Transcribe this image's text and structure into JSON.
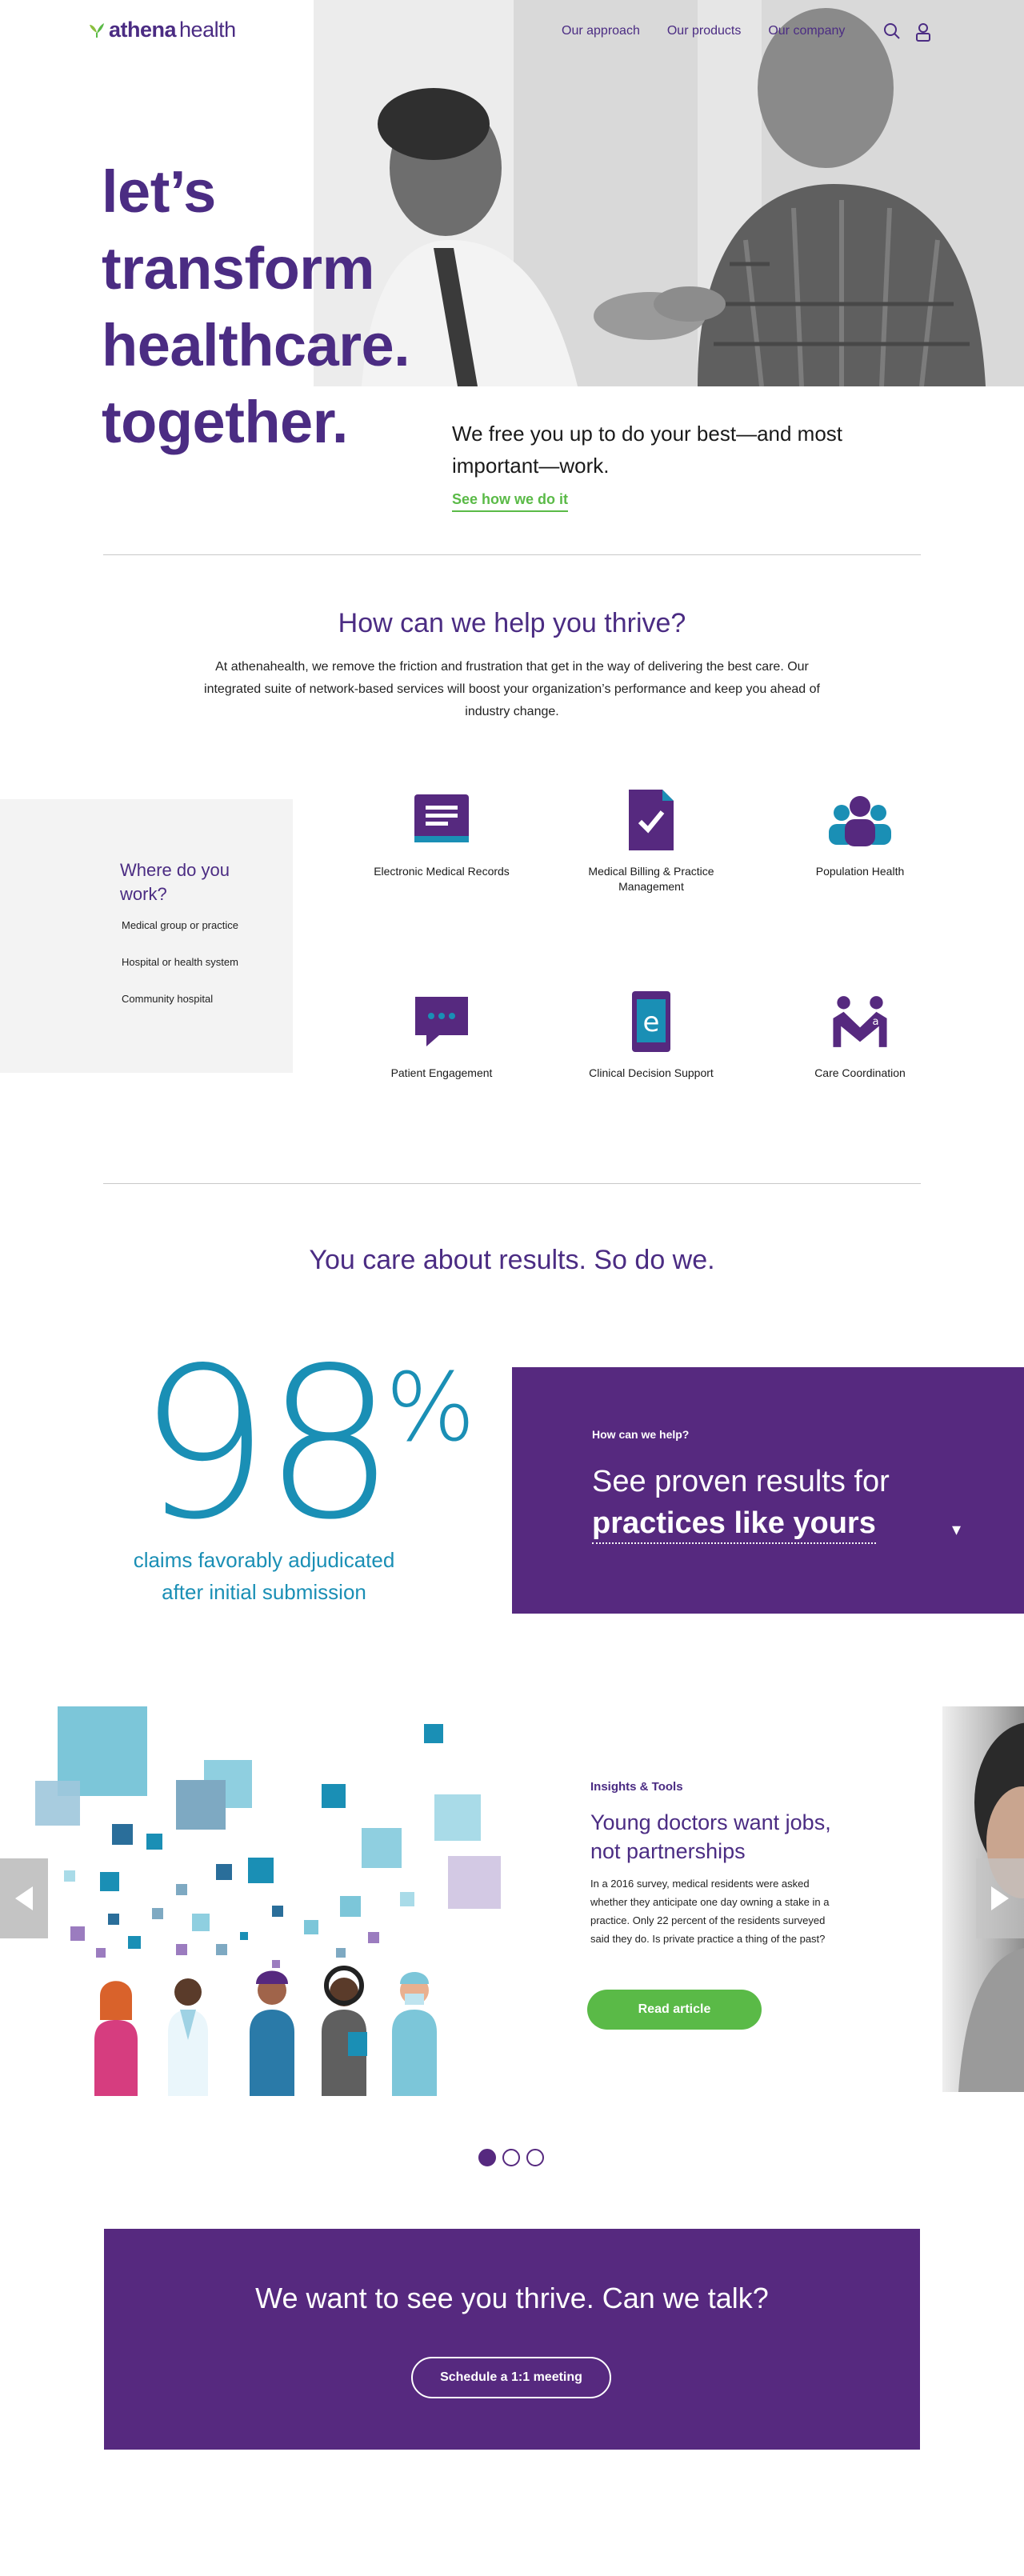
{
  "header": {
    "logo_text_bold": "athena",
    "logo_text_light": "health",
    "nav": [
      "Our approach",
      "Our products",
      "Our company"
    ],
    "icons": [
      "search-icon",
      "user-icon"
    ]
  },
  "hero": {
    "title_lines": [
      "let’s",
      "transform",
      "healthcare.",
      "together."
    ],
    "subtitle": "We free you up to do your best—and most important—work.",
    "link": "See how we do it"
  },
  "help": {
    "title": "How can we help you thrive?",
    "intro": "At athenahealth, we remove the friction and frustration that get in the way of delivering the best care. Our integrated suite of network-based services will boost your organization’s performance and keep you ahead of industry change."
  },
  "where": {
    "title": "Where do you work?",
    "options": [
      "Medical group or practice",
      "Hospital or health system",
      "Community hospital"
    ]
  },
  "services": [
    {
      "label": "Electronic Medical Records",
      "icon": "records-icon"
    },
    {
      "label": "Medical Billing & Practice Management",
      "icon": "billing-icon"
    },
    {
      "label": "Population Health",
      "icon": "population-icon"
    },
    {
      "label": "Patient Engagement",
      "icon": "chat-icon"
    },
    {
      "label": "Clinical Decision Support",
      "icon": "decision-icon"
    },
    {
      "label": "Care Coordination",
      "icon": "coordination-icon"
    }
  ],
  "results": {
    "title": "You care about results. So do we.",
    "stat_value": "98",
    "stat_unit": "%",
    "stat_caption": "claims favorably adjudicated after initial submission",
    "kicker": "How can we help?",
    "line1": "See proven results for",
    "line2": "practices like yours",
    "caret": "▾"
  },
  "carousel": {
    "kicker": "Insights & Tools",
    "title": "Young doctors want jobs, not partnerships",
    "body": "In a 2016 survey, medical residents were asked whether they anticipate one day owning a stake in a practice. Only 22 percent of the residents surveyed said they do. Is private practice a thing of the past?",
    "button": "Read article",
    "slide_count": 3,
    "active_slide": 1
  },
  "cta": {
    "title": "We want to see you thrive. Can we talk?",
    "button": "Schedule a 1:1 meeting"
  },
  "colors": {
    "purple": "#4b2c83",
    "deep_purple": "#56297f",
    "green": "#5aba47",
    "teal": "#1a8fb5"
  }
}
